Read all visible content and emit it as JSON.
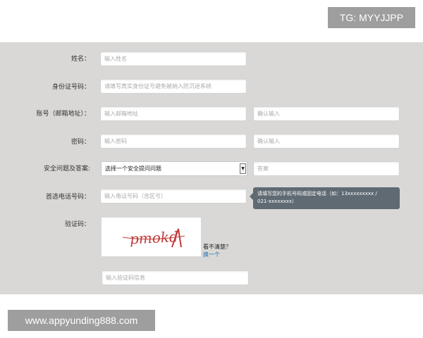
{
  "watermark_top": "TG: MYYJJPP",
  "watermark_bottom": "www.appyunding888.com",
  "form": {
    "name": {
      "label": "姓名：",
      "placeholder": "输入姓名"
    },
    "id_number": {
      "label": "身份证号码：",
      "placeholder": "请填写真实身份证号避免被纳入防沉迷系统"
    },
    "account": {
      "label": "账号（邮箱地址）：",
      "placeholder": "输入邮箱地址",
      "confirm_placeholder": "确认输入"
    },
    "password": {
      "label": "密码：",
      "placeholder": "输入密码",
      "confirm_placeholder": "确认输入"
    },
    "security": {
      "label": "安全问题及答案:",
      "select_value": "选择一个安全提问问题",
      "answer_placeholder": "答案"
    },
    "phone": {
      "label": "首选电话号码：",
      "placeholder": "输入电话号码（含区号）",
      "tooltip_line1": "请填写您的手机号码或固定电话（如：13xxxxxxxxx /",
      "tooltip_line2": "021-xxxxxxxx）"
    },
    "captcha": {
      "label": "验证码：",
      "image_text": "pmokd",
      "hint": "看不清楚？",
      "refresh": "换一个",
      "input_placeholder": "输入验证码信息"
    }
  }
}
